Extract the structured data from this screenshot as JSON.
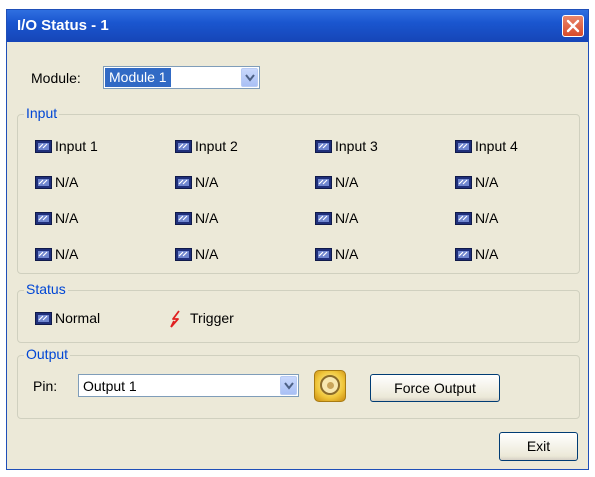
{
  "window": {
    "title": "I/O Status - 1"
  },
  "module": {
    "label": "Module:",
    "value": "Module 1"
  },
  "input_group": {
    "legend": "Input",
    "rows": [
      [
        "Input 1",
        "Input 2",
        "Input 3",
        "Input 4"
      ],
      [
        "N/A",
        "N/A",
        "N/A",
        "N/A"
      ],
      [
        "N/A",
        "N/A",
        "N/A",
        "N/A"
      ],
      [
        "N/A",
        "N/A",
        "N/A",
        "N/A"
      ]
    ]
  },
  "status_group": {
    "legend": "Status",
    "normal": "Normal",
    "trigger": "Trigger"
  },
  "output_group": {
    "legend": "Output",
    "pin_label": "Pin:",
    "pin_value": "Output 1",
    "force_button": "Force Output"
  },
  "exit_button": "Exit",
  "colors": {
    "title_bar": "#1a56cf",
    "legend_text": "#0046d5",
    "trigger": "#e02020",
    "selection": "#316ac5"
  },
  "icons": {
    "io": "io-chip-icon",
    "trigger": "lightning-icon",
    "output_led": "output-led-icon",
    "close": "close-icon",
    "dropdown": "chevron-down-icon"
  }
}
